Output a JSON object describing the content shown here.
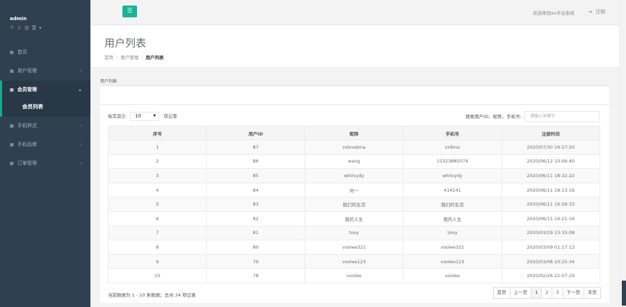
{
  "sidebar": {
    "user": "admin",
    "settings": "个 人 设 置 ▾",
    "items": [
      {
        "icon": "grid-icon",
        "label": "首页",
        "chevron": ""
      },
      {
        "icon": "grid-icon",
        "label": "用户管理",
        "chevron": "‹"
      },
      {
        "icon": "grid-icon",
        "label": "会员管理",
        "chevron": "⌄"
      },
      {
        "icon": "grid-icon",
        "label": "手机样式",
        "chevron": "‹"
      },
      {
        "icon": "grid-icon",
        "label": "手机品牌",
        "chevron": "‹"
      },
      {
        "icon": "grid-icon",
        "label": "订单管理",
        "chevron": "‹"
      }
    ],
    "sub_item": "会员列表"
  },
  "topbar": {
    "menu_icon": "hamburger-icon",
    "welcome": "欢迎来到xx平台系统",
    "logout": "注销"
  },
  "heading": {
    "title": "用户列表",
    "breadcrumb": [
      "首页",
      "用户管理",
      "用户列表"
    ]
  },
  "panel": {
    "title": "用户列表",
    "length_prefix": "每页显示",
    "length_value": "10",
    "length_suffix": "项记录",
    "search_label": "搜索用户ID、昵称、手机号:",
    "search_placeholder": "请输入关键字"
  },
  "table": {
    "columns": [
      "序号",
      "用户ID",
      "昵称",
      "手机号",
      "注册时间"
    ],
    "rows": [
      [
        "1",
        "87",
        "zxlovebna",
        "zxibna",
        "2020/07/30 16:17:20"
      ],
      [
        "2",
        "86",
        "wang",
        "15323885074",
        "2020/06/12 10:06:40"
      ],
      [
        "3",
        "85",
        "whilvydy",
        "whilvydy",
        "2020/06/11 18:32:22"
      ],
      [
        "4",
        "84",
        "何一",
        "414141",
        "2020/06/11 18:13:16"
      ],
      [
        "5",
        "83",
        "我们的生活",
        "我们的生活",
        "2020/06/11 16:26:33"
      ],
      [
        "6",
        "82",
        "我的人生",
        "我的人生",
        "2020/06/11 16:21:16"
      ],
      [
        "7",
        "81",
        "tooy",
        "tooy",
        "2020/03/29 13:33:08"
      ],
      [
        "8",
        "80",
        "voolee321",
        "voolee321",
        "2020/03/09 01:17:13"
      ],
      [
        "9",
        "79",
        "voolee123",
        "voolee123",
        "2020/03/08 20:25:34"
      ],
      [
        "10",
        "78",
        "voolee",
        "voolee",
        "2020/02/26 22:07:29"
      ]
    ]
  },
  "footer": {
    "info": "当前数据为 1 - 10 条数据；总共 24 项记录",
    "pager": [
      "首页",
      "上一页",
      "1",
      "2",
      "3",
      "下一页",
      "末页"
    ],
    "current_page": "1"
  }
}
